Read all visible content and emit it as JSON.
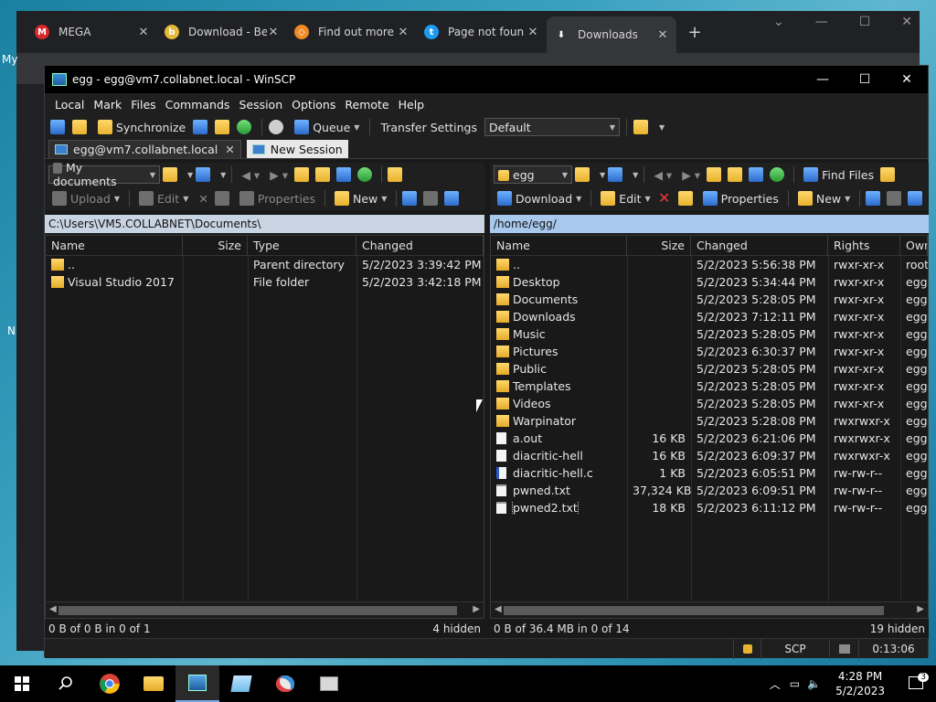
{
  "desktop": {
    "label_1": "My",
    "label_2": "N"
  },
  "browser": {
    "tabs": [
      {
        "title": "MEGA",
        "icon": "mega-icon",
        "color": "#d9272e",
        "glyph": "M"
      },
      {
        "title": "Download - Be",
        "icon": "bee-icon",
        "color": "#e5b93a",
        "glyph": "b"
      },
      {
        "title": "Find out more",
        "icon": "diamond-icon",
        "color": "#f08a24",
        "glyph": "◇"
      },
      {
        "title": "Page not foun",
        "icon": "twitter-icon",
        "color": "#1d9bf0",
        "glyph": "t"
      },
      {
        "title": "Downloads",
        "icon": "download-icon",
        "color": "#35363a",
        "glyph": "⬇"
      }
    ],
    "new_tab": "+"
  },
  "winscp": {
    "title": "egg - egg@vm7.collabnet.local - WinSCP",
    "menu": [
      "Local",
      "Mark",
      "Files",
      "Commands",
      "Session",
      "Options",
      "Remote",
      "Help"
    ],
    "toolbar": {
      "synchronize": "Synchronize",
      "queue": "Queue",
      "transfer_settings_label": "Transfer Settings",
      "transfer_settings_value": "Default"
    },
    "session_tabs": {
      "active": "egg@vm7.collabnet.local",
      "new": "New Session"
    },
    "left": {
      "location": "My documents",
      "actions": {
        "upload": "Upload",
        "edit": "Edit",
        "properties": "Properties",
        "new": "New"
      },
      "path": "C:\\Users\\VM5.COLLABNET\\Documents\\",
      "columns": [
        "Name",
        "Size",
        "Type",
        "Changed"
      ],
      "rows": [
        {
          "name": "..",
          "size": "",
          "type": "Parent directory",
          "changed": "5/2/2023  3:39:42 PM",
          "kind": "up"
        },
        {
          "name": "Visual Studio 2017",
          "size": "",
          "type": "File folder",
          "changed": "5/2/2023  3:42:18 PM",
          "kind": "folder"
        }
      ],
      "status": "0 B of 0 B in 0 of 1",
      "hidden": "4 hidden"
    },
    "right": {
      "location": "egg",
      "find_files": "Find Files",
      "actions": {
        "download": "Download",
        "edit": "Edit",
        "properties": "Properties",
        "new": "New"
      },
      "path": "/home/egg/",
      "columns": [
        "Name",
        "Size",
        "Changed",
        "Rights",
        "Owr"
      ],
      "rows": [
        {
          "name": "..",
          "size": "",
          "changed": "5/2/2023 5:56:38 PM",
          "rights": "rwxr-xr-x",
          "owner": "root",
          "kind": "up"
        },
        {
          "name": "Desktop",
          "size": "",
          "changed": "5/2/2023 5:34:44 PM",
          "rights": "rwxr-xr-x",
          "owner": "egg",
          "kind": "folder"
        },
        {
          "name": "Documents",
          "size": "",
          "changed": "5/2/2023 5:28:05 PM",
          "rights": "rwxr-xr-x",
          "owner": "egg",
          "kind": "folder"
        },
        {
          "name": "Downloads",
          "size": "",
          "changed": "5/2/2023 7:12:11 PM",
          "rights": "rwxr-xr-x",
          "owner": "egg",
          "kind": "folder"
        },
        {
          "name": "Music",
          "size": "",
          "changed": "5/2/2023 5:28:05 PM",
          "rights": "rwxr-xr-x",
          "owner": "egg",
          "kind": "folder"
        },
        {
          "name": "Pictures",
          "size": "",
          "changed": "5/2/2023 6:30:37 PM",
          "rights": "rwxr-xr-x",
          "owner": "egg",
          "kind": "folder"
        },
        {
          "name": "Public",
          "size": "",
          "changed": "5/2/2023 5:28:05 PM",
          "rights": "rwxr-xr-x",
          "owner": "egg",
          "kind": "folder"
        },
        {
          "name": "Templates",
          "size": "",
          "changed": "5/2/2023 5:28:05 PM",
          "rights": "rwxr-xr-x",
          "owner": "egg",
          "kind": "folder"
        },
        {
          "name": "Videos",
          "size": "",
          "changed": "5/2/2023 5:28:05 PM",
          "rights": "rwxr-xr-x",
          "owner": "egg",
          "kind": "folder"
        },
        {
          "name": "Warpinator",
          "size": "",
          "changed": "5/2/2023 5:28:08 PM",
          "rights": "rwxrwxr-x",
          "owner": "egg",
          "kind": "folder"
        },
        {
          "name": "a.out",
          "size": "16 KB",
          "changed": "5/2/2023 6:21:06 PM",
          "rights": "rwxrwxr-x",
          "owner": "egg",
          "kind": "file"
        },
        {
          "name": "diacritic-hell",
          "size": "16 KB",
          "changed": "5/2/2023 6:09:37 PM",
          "rights": "rwxrwxr-x",
          "owner": "egg",
          "kind": "file"
        },
        {
          "name": "diacritic-hell.c",
          "size": "1 KB",
          "changed": "5/2/2023 6:05:51 PM",
          "rights": "rw-rw-r--",
          "owner": "egg",
          "kind": "c"
        },
        {
          "name": "pwned.txt",
          "size": "37,324 KB",
          "changed": "5/2/2023 6:09:51 PM",
          "rights": "rw-rw-r--",
          "owner": "egg",
          "kind": "txt"
        },
        {
          "name": "pwned2.txt",
          "size": "18 KB",
          "changed": "5/2/2023 6:11:12 PM",
          "rights": "rw-rw-r--",
          "owner": "egg",
          "kind": "txt"
        }
      ],
      "status": "0 B of 36.4 MB in 0 of 14",
      "hidden": "19 hidden"
    },
    "statusbar": {
      "protocol": "SCP",
      "elapsed": "0:13:06"
    }
  },
  "taskbar": {
    "time": "4:28 PM",
    "date": "5/2/2023",
    "notifications": "3"
  }
}
